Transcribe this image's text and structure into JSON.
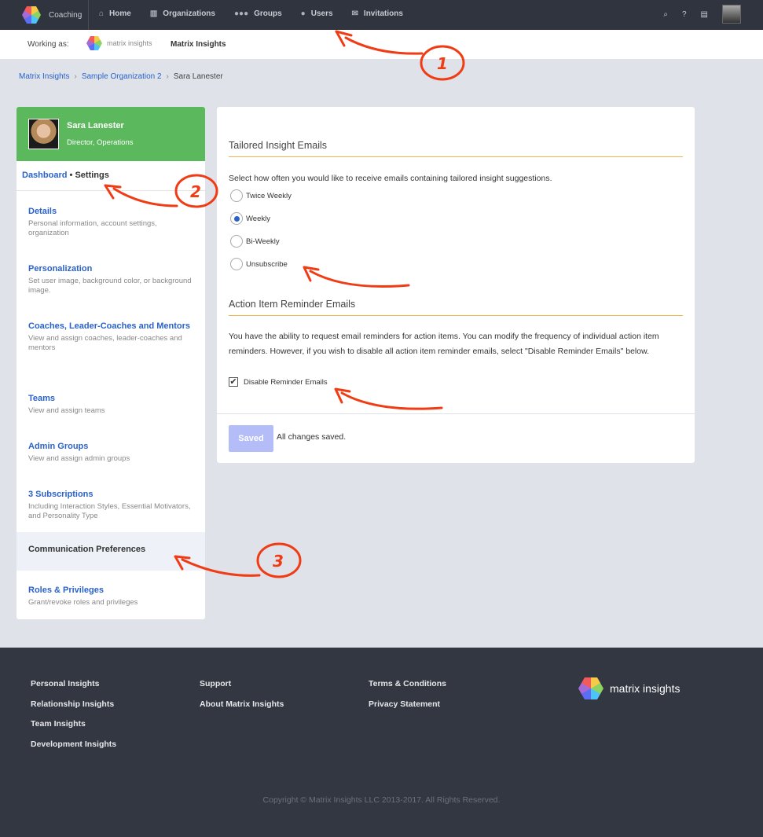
{
  "nav": {
    "app": "Coaching",
    "links": [
      {
        "label": "Home",
        "icon": "home-icon"
      },
      {
        "label": "Organizations",
        "icon": "building-icon"
      },
      {
        "label": "Groups",
        "icon": "users-group-icon"
      },
      {
        "label": "Users",
        "icon": "user-icon"
      },
      {
        "label": "Invitations",
        "icon": "envelope-icon"
      }
    ],
    "right_icons": [
      "search-icon",
      "help-icon",
      "briefcase-icon",
      "avatar"
    ]
  },
  "working": {
    "label": "Working as:",
    "logo_text": "matrix insights",
    "org": "Matrix Insights"
  },
  "breadcrumb": [
    "Matrix Insights",
    "Sample Organization 2",
    "Sara Lanester"
  ],
  "profile": {
    "name": "Sara Lanester",
    "title": "Director, Operations"
  },
  "side_tabs": {
    "dashboard": "Dashboard",
    "sep": "•",
    "settings": "Settings"
  },
  "menu": [
    {
      "title": "Details",
      "desc": "Personal information, account settings, organization"
    },
    {
      "title": "Personalization",
      "desc": "Set user image, background color, or background image."
    },
    {
      "title": "Coaches, Leader-Coaches and Mentors",
      "desc": "View and assign coaches, leader-coaches and mentors"
    },
    {
      "title": "Teams",
      "desc": "View and assign teams"
    },
    {
      "title": "Admin Groups",
      "desc": "View and assign admin groups"
    },
    {
      "title": "3 Subscriptions",
      "desc": "Including Interaction Styles, Essential Motivators, and Personality Type"
    },
    {
      "title": "Communication Preferences",
      "desc": ""
    },
    {
      "title": "Roles & Privileges",
      "desc": "Grant/revoke roles and privileges"
    }
  ],
  "insight": {
    "heading": "Tailored Insight Emails",
    "text": "Select how often you would like to receive emails containing tailored insight suggestions.",
    "options": [
      "Twice Weekly",
      "Weekly",
      "Bi-Weekly",
      "Unsubscribe"
    ],
    "selected": "Weekly"
  },
  "reminder": {
    "heading": "Action Item Reminder Emails",
    "text": "You have the ability to request email reminders for action items. You can modify the frequency of individual action item reminders. However, if you wish to disable all action item reminder emails, select \"Disable Reminder Emails\" below.",
    "checkbox": "Disable Reminder Emails",
    "checked": true
  },
  "save": {
    "button": "Saved",
    "message": "All changes saved."
  },
  "footer": {
    "col1": [
      "Personal Insights",
      "Relationship Insights",
      "Team Insights",
      "Development Insights"
    ],
    "col2": [
      "Support",
      "About Matrix Insights"
    ],
    "col3": [
      "Terms & Conditions",
      "Privacy Statement"
    ],
    "logo_text": "matrix insights",
    "copyright": "Copyright © Matrix Insights LLC 2013-2017. All Rights Reserved."
  },
  "annotations": [
    "1",
    "2",
    "3"
  ],
  "colors": {
    "nav": "#2f343e",
    "green": "#5cb85c",
    "link": "#2a62c9",
    "accent_line": "#f0b64a",
    "saved_button": "#b4bdf7",
    "annotation": "#f03c15"
  }
}
